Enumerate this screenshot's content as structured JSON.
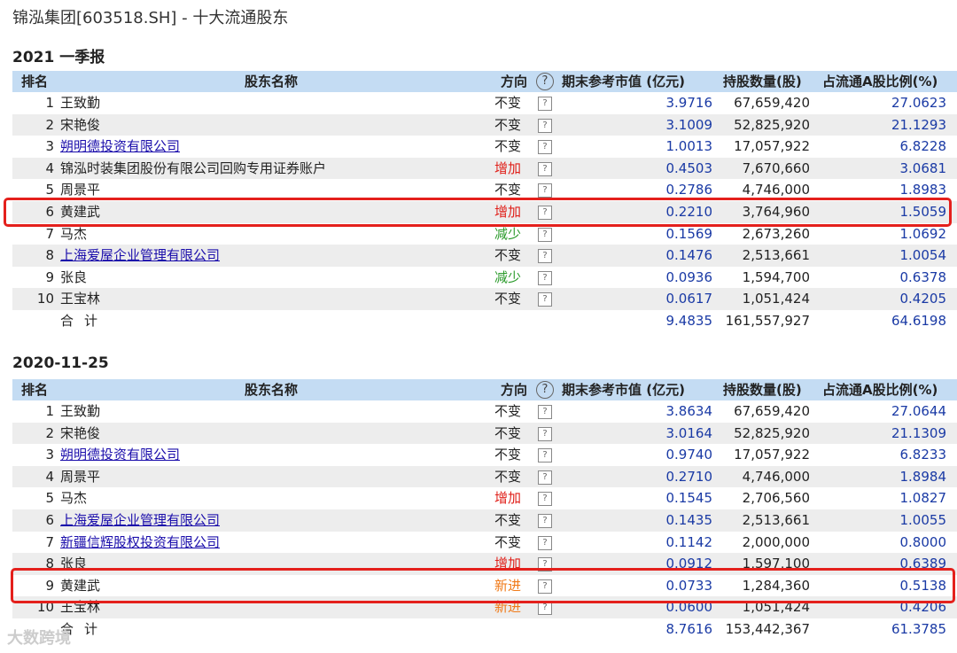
{
  "page": {
    "title": "锦泓集团[603518.SH] - 十大流通股东"
  },
  "columns": {
    "rank": "排名",
    "name": "股东名称",
    "direction": "方向",
    "help": "?",
    "market_value": "期末参考市值 (亿元)",
    "shares": "持股数量(股)",
    "ratio": "占流通A股比例(%)"
  },
  "row_help": "?",
  "sections": [
    {
      "title": "2021 一季报",
      "rows": [
        {
          "rank": "1",
          "name": "王致勤",
          "direction": "不变",
          "mv": "3.9716",
          "shares": "67,659,420",
          "ratio": "27.0623"
        },
        {
          "rank": "2",
          "name": "宋艳俊",
          "direction": "不变",
          "mv": "3.1009",
          "shares": "52,825,920",
          "ratio": "21.1293"
        },
        {
          "rank": "3",
          "name": "朔明德投资有限公司",
          "direction": "不变",
          "mv": "1.0013",
          "shares": "17,057,922",
          "ratio": "6.8228"
        },
        {
          "rank": "4",
          "name": "锦泓时装集团股份有限公司回购专用证券账户",
          "direction": "增加",
          "mv": "0.4503",
          "shares": "7,670,660",
          "ratio": "3.0681"
        },
        {
          "rank": "5",
          "name": "周景平",
          "direction": "不变",
          "mv": "0.2786",
          "shares": "4,746,000",
          "ratio": "1.8983"
        },
        {
          "rank": "6",
          "name": "黄建武",
          "direction": "增加",
          "mv": "0.2210",
          "shares": "3,764,960",
          "ratio": "1.5059"
        },
        {
          "rank": "7",
          "name": "马杰",
          "direction": "减少",
          "mv": "0.1569",
          "shares": "2,673,260",
          "ratio": "1.0692"
        },
        {
          "rank": "8",
          "name": "上海爱屋企业管理有限公司",
          "direction": "不变",
          "mv": "0.1476",
          "shares": "2,513,661",
          "ratio": "1.0054"
        },
        {
          "rank": "9",
          "name": "张良",
          "direction": "减少",
          "mv": "0.0936",
          "shares": "1,594,700",
          "ratio": "0.6378"
        },
        {
          "rank": "10",
          "name": "王宝林",
          "direction": "不变",
          "mv": "0.0617",
          "shares": "1,051,424",
          "ratio": "0.4205"
        }
      ],
      "total": {
        "label": "合计",
        "mv": "9.4835",
        "shares": "161,557,927",
        "ratio": "64.6198"
      }
    },
    {
      "title": "2020-11-25",
      "rows": [
        {
          "rank": "1",
          "name": "王致勤",
          "direction": "不变",
          "mv": "3.8634",
          "shares": "67,659,420",
          "ratio": "27.0644"
        },
        {
          "rank": "2",
          "name": "宋艳俊",
          "direction": "不变",
          "mv": "3.0164",
          "shares": "52,825,920",
          "ratio": "21.1309"
        },
        {
          "rank": "3",
          "name": "朔明德投资有限公司",
          "direction": "不变",
          "mv": "0.9740",
          "shares": "17,057,922",
          "ratio": "6.8233"
        },
        {
          "rank": "4",
          "name": "周景平",
          "direction": "不变",
          "mv": "0.2710",
          "shares": "4,746,000",
          "ratio": "1.8984"
        },
        {
          "rank": "5",
          "name": "马杰",
          "direction": "增加",
          "mv": "0.1545",
          "shares": "2,706,560",
          "ratio": "1.0827"
        },
        {
          "rank": "6",
          "name": "上海爱屋企业管理有限公司",
          "direction": "不变",
          "mv": "0.1435",
          "shares": "2,513,661",
          "ratio": "1.0055"
        },
        {
          "rank": "7",
          "name": "新疆信辉股权投资有限公司",
          "direction": "不变",
          "mv": "0.1142",
          "shares": "2,000,000",
          "ratio": "0.8000"
        },
        {
          "rank": "8",
          "name": "张良",
          "direction": "增加",
          "mv": "0.0912",
          "shares": "1,597,100",
          "ratio": "0.6389"
        },
        {
          "rank": "9",
          "name": "黄建武",
          "direction": "新进",
          "mv": "0.0733",
          "shares": "1,284,360",
          "ratio": "0.5138"
        },
        {
          "rank": "10",
          "name": "王宝林",
          "direction": "新进",
          "mv": "0.0600",
          "shares": "1,051,424",
          "ratio": "0.4206"
        }
      ],
      "total": {
        "label": "合计",
        "mv": "8.7616",
        "shares": "153,442,367",
        "ratio": "61.3785"
      }
    }
  ],
  "watermark": "大数跨境",
  "colors": {
    "header_bg": "#c4dcf3",
    "link": "#1a0dab",
    "value_blue": "#1a3aa5",
    "increase": "#e0201a",
    "decrease": "#2a9a2a",
    "new": "#f07a18",
    "highlight": "#e4201c"
  }
}
